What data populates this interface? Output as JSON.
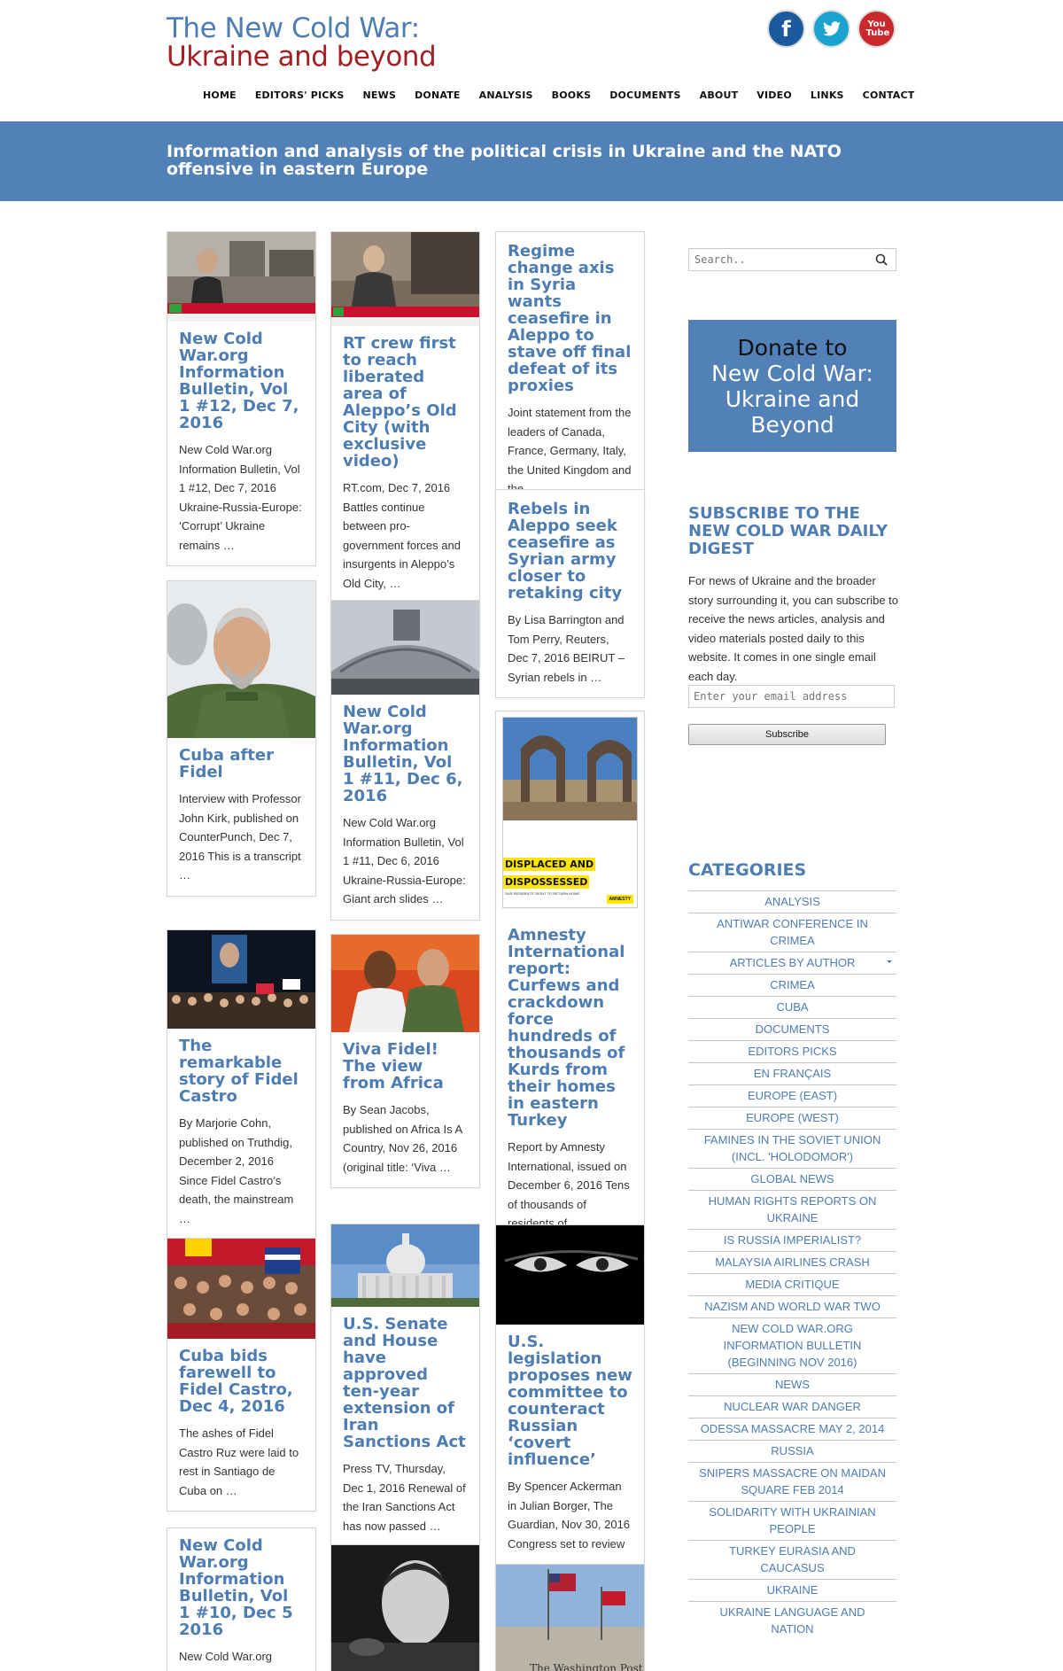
{
  "site": {
    "title_line1": "The New Cold War:",
    "title_line2": "Ukraine and beyond"
  },
  "social": {
    "facebook": "f",
    "twitter": "t",
    "youtube": "You Tube"
  },
  "nav": [
    "HOME",
    "EDITORS' PICKS",
    "NEWS",
    "DONATE",
    "ANALYSIS",
    "BOOKS",
    "DOCUMENTS",
    "ABOUT",
    "VIDEO",
    "LINKS",
    "CONTACT"
  ],
  "banner": "Information and analysis of the political crisis in Ukraine and the NATO offensive in eastern Europe",
  "cards": [
    {
      "title": "New Cold War.org Information Bulletin, Vol 1 #12, Dec 7, 2016",
      "excerpt": "New Cold War.org Information Bulletin, Vol 1 #12, Dec 7, 2016 Ukraine-Russia-Europe: ‘Corrupt’ Ukraine remains …"
    },
    {
      "title": "RT crew first to reach liberated area of Aleppo’s Old City (with exclusive video)",
      "excerpt": "RT.com, Dec 7, 2016 Battles continue between pro-government forces and insurgents in Aleppo’s Old City, …"
    },
    {
      "title": "Regime change axis in Syria wants ceasefire in Aleppo to stave off final defeat of its proxies",
      "excerpt": "Joint statement from the leaders of Canada, France, Germany, Italy, the United Kingdom and the …"
    },
    {
      "title": "Rebels in Aleppo seek ceasefire as Syrian army closer to retaking city",
      "excerpt": "By Lisa Barrington and Tom Perry, Reuters, Dec 7, 2016 BEIRUT – Syrian rebels in …"
    },
    {
      "title": "Cuba after Fidel",
      "excerpt": "Interview with Professor John Kirk, published on CounterPunch, Dec 7, 2016 This is a transcript …"
    },
    {
      "title": "New Cold War.org Information Bulletin, Vol 1 #11, Dec 6, 2016",
      "excerpt": "New Cold War.org Information Bulletin, Vol 1 #11, Dec 6, 2016 Ukraine-Russia-Europe: Giant arch slides …"
    },
    {
      "title": "Amnesty International report: Curfews and crackdown force hundreds of thousands of Kurds from their homes in eastern Turkey",
      "excerpt": "Report by Amnesty International, issued on December 6, 2016 Tens of thousands of residents of …",
      "image_text1": "DISPLACED AND",
      "image_text2": "DISPOSSESSED",
      "image_text3": "SUR RESIDENTS' RIGHT TO RETURN HOME",
      "image_logo": "AMNESTY"
    },
    {
      "title": "The remarkable story of Fidel Castro",
      "excerpt": "By Marjorie Cohn, published on Truthdig, December 2, 2016 Since Fidel Castro’s death, the mainstream …"
    },
    {
      "title": "Viva Fidel! The view from Africa",
      "excerpt": "By Sean Jacobs, published on Africa Is A Country, Nov 26, 2016 (original title: ‘Viva …"
    },
    {
      "title": "Cuba bids farewell to Fidel Castro, Dec 4, 2016",
      "excerpt": "The ashes of Fidel Castro Ruz were laid to rest in Santiago de Cuba on …"
    },
    {
      "title": "U.S. Senate and House have approved ten-year extension of Iran Sanctions Act",
      "excerpt": "Press TV, Thursday, Dec 1, 2016 Renewal of the Iran Sanctions Act has now passed …"
    },
    {
      "title": "U.S. legislation proposes new committee to counteract Russian ‘covert influence’",
      "excerpt": "By Spencer Ackerman in Julian Borger, The Guardian, Nov 30, 2016 Congress set to review …"
    },
    {
      "title": "New Cold War.org Information Bulletin, Vol 1 #10, Dec 5 2016",
      "excerpt": "New Cold War.org Information Bulletin, …"
    },
    {
      "title": "",
      "excerpt": ""
    },
    {
      "title": "",
      "excerpt": "",
      "image_text1": "The Washington Post"
    }
  ],
  "sidebar": {
    "search_placeholder": "Search..",
    "donate_line1": "Donate to",
    "donate_line2": "New Cold War:",
    "donate_line3": "Ukraine and",
    "donate_line4": "Beyond",
    "subscribe_title": "SUBSCRIBE TO THE NEW COLD WAR DAILY DIGEST",
    "subscribe_text": "For news of Ukraine and the broader story surrounding it, you can subscribe to receive the news articles, analysis and video materials posted daily to this website. It comes in one single email each day.",
    "email_placeholder": "Enter your email address",
    "subscribe_button": "Subscribe",
    "categories_title": "CATEGORIES",
    "categories": [
      "ANALYSIS",
      "ANTIWAR CONFERENCE IN CRIMEA",
      "ARTICLES BY AUTHOR",
      "CRIMEA",
      "CUBA",
      "DOCUMENTS",
      "EDITORS PICKS",
      "EN FRANÇAIS",
      "EUROPE (EAST)",
      "EUROPE (WEST)",
      "FAMINES IN THE SOVIET UNION (INCL. 'HOLODOMOR')",
      "GLOBAL NEWS",
      "HUMAN RIGHTS REPORTS ON UKRAINE",
      "IS RUSSIA IMPERIALIST?",
      "MALAYSIA AIRLINES CRASH",
      "MEDIA CRITIQUE",
      "NAZISM AND WORLD WAR TWO",
      "NEW COLD WAR.ORG INFORMATION BULLETIN (BEGINNING NOV 2016)",
      "NEWS",
      "NUCLEAR WAR DANGER",
      "ODESSA MASSACRE MAY 2, 2014",
      "RUSSIA",
      "SNIPERS MASSACRE ON MAIDAN SQUARE FEB 2014",
      "SOLIDARITY WITH UKRAINIAN PEOPLE",
      "TURKEY EURASIA AND CAUCASUS",
      "UKRAINE",
      "UKRAINE LANGUAGE AND NATION"
    ]
  },
  "colors": {
    "brand_blue": "#4d7db3",
    "brand_red": "#a31f24",
    "banner_bg": "#5281b8"
  }
}
